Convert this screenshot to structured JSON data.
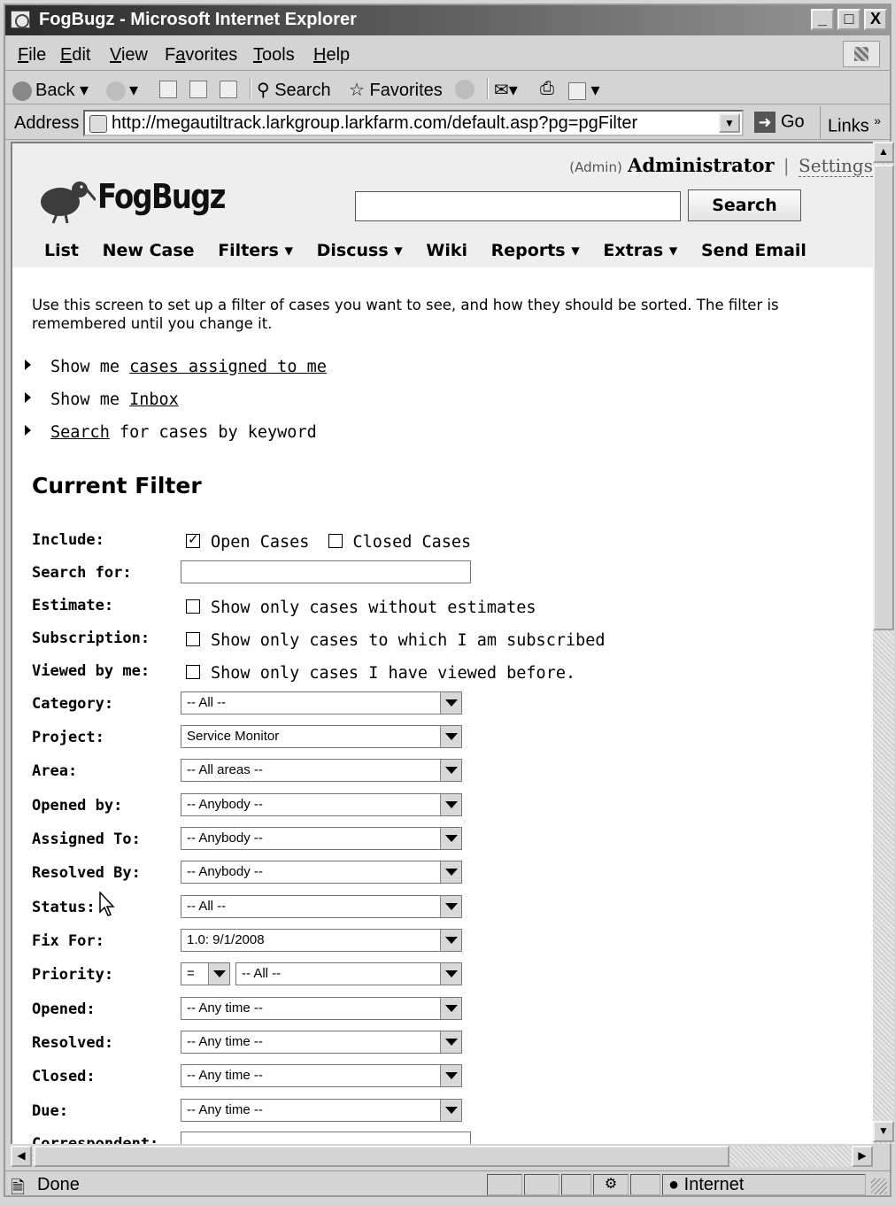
{
  "window": {
    "title": "FogBugz - Microsoft Internet Explorer",
    "minimize": "_",
    "maximize": "□",
    "close": "X"
  },
  "menu": [
    {
      "label": "File",
      "hot": "F",
      "rest": "ile"
    },
    {
      "label": "Edit",
      "hot": "E",
      "rest": "dit"
    },
    {
      "label": "View",
      "hot": "V",
      "rest": "iew"
    },
    {
      "label": "Favorites",
      "hot": "a",
      "pre": "F",
      "rest": "vorites"
    },
    {
      "label": "Tools",
      "hot": "T",
      "rest": "ools"
    },
    {
      "label": "Help",
      "hot": "H",
      "rest": "elp"
    }
  ],
  "toolbar": {
    "back_label": "Back",
    "search_label": "Search",
    "favorites_label": "Favorites"
  },
  "address": {
    "label": "Address",
    "url": "http://megautiltrack.larkgroup.larkfarm.com/default.asp?pg=pgFilter",
    "go_label": "Go",
    "links_label": "Links"
  },
  "header": {
    "role": "(Admin)",
    "user": "Administrator",
    "separator": "|",
    "settings": "Settings",
    "logo_text": "FogBugz",
    "search_value": "",
    "search_button": "Search"
  },
  "nav": [
    {
      "label": "List"
    },
    {
      "label": "New Case"
    },
    {
      "label": "Filters ▾"
    },
    {
      "label": "Discuss ▾"
    },
    {
      "label": "Wiki"
    },
    {
      "label": "Reports ▾"
    },
    {
      "label": "Extras ▾"
    },
    {
      "label": "Send Email"
    }
  ],
  "intro": "Use this screen to set up a filter of cases you want to see, and how they should be sorted. The filter is remembered until you change it.",
  "quick_links": [
    {
      "pre": "Show me ",
      "link": "cases assigned to me",
      "post": ""
    },
    {
      "pre": "Show me ",
      "link": "Inbox",
      "post": ""
    },
    {
      "pre": "",
      "link": "Search",
      "post": " for cases by keyword"
    }
  ],
  "filter": {
    "title": "Current Filter",
    "include_label": "Include:",
    "open_cases": "Open Cases",
    "open_checked": true,
    "closed_cases": "Closed Cases",
    "closed_checked": false,
    "search_label": "Search for:",
    "search_value": "",
    "estimate_label": "Estimate:",
    "estimate_text": "Show only cases without estimates",
    "subscription_label": "Subscription:",
    "subscription_text": "Show only cases to which I am subscribed",
    "viewed_label": "Viewed by me:",
    "viewed_text": "Show only cases I have viewed before.",
    "selects": [
      {
        "label": "Category:",
        "value": "-- All --"
      },
      {
        "label": "Project:",
        "value": "Service Monitor"
      },
      {
        "label": "Area:",
        "value": "-- All areas --"
      },
      {
        "label": "Opened by:",
        "value": "-- Anybody --"
      },
      {
        "label": "Assigned To:",
        "value": "-- Anybody --"
      },
      {
        "label": "Resolved By:",
        "value": "-- Anybody --"
      },
      {
        "label": "Status:",
        "value": "-- All --"
      },
      {
        "label": "Fix For:",
        "value": "1.0: 9/1/2008"
      }
    ],
    "priority_label": "Priority:",
    "priority_op": "=",
    "priority_value": "-- All --",
    "date_selects": [
      {
        "label": "Opened:",
        "value": "-- Any time --"
      },
      {
        "label": "Resolved:",
        "value": "-- Any time --"
      },
      {
        "label": "Closed:",
        "value": "-- Any time --"
      },
      {
        "label": "Due:",
        "value": "-- Any time --"
      }
    ],
    "correspondent_label": "Correspondent:"
  },
  "status": {
    "left": "Done",
    "zone": "Internet"
  },
  "colors": {
    "header_bg": "#eeeeee",
    "page_bg": "#ffffff",
    "chrome": "#d4d4d4"
  }
}
